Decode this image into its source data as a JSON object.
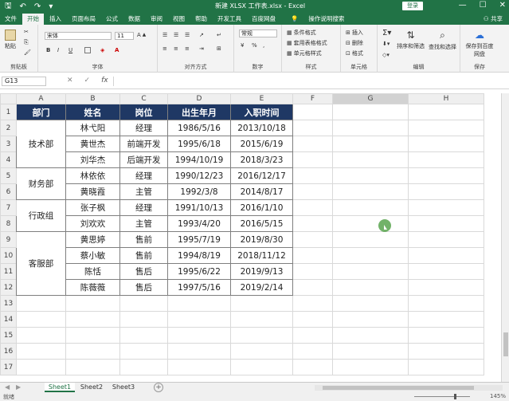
{
  "titlebar": {
    "title": "新建 XLSX 工作表.xlsx  -  Excel",
    "login": "登录",
    "save_icon": "save-icon",
    "undo_icon": "undo-icon",
    "redo_icon": "redo-icon",
    "min": "—",
    "max": "☐",
    "close": "✕"
  },
  "tabs": [
    "文件",
    "开始",
    "插入",
    "页面布局",
    "公式",
    "数据",
    "审阅",
    "视图",
    "帮助",
    "开发工具",
    "百度网盘"
  ],
  "tellme": "操作说明搜索",
  "share": "共享",
  "ribbon": {
    "clipboard": {
      "label": "剪贴板",
      "paste": "粘贴"
    },
    "font": {
      "label": "字体",
      "name": "宋体",
      "size": "11",
      "bold": "B",
      "italic": "I",
      "underline": "U"
    },
    "align": {
      "label": "对齐方式"
    },
    "number": {
      "label": "数字",
      "format": "常规"
    },
    "styles": {
      "label": "样式",
      "cond": "条件格式",
      "table": "套用表格格式",
      "cell": "单元格样式"
    },
    "cells": {
      "label": "单元格",
      "insert": "插入",
      "delete": "删除",
      "format": "格式"
    },
    "editing": {
      "label": "编辑",
      "sort": "排序和筛选",
      "find": "查找和选择"
    },
    "save": {
      "label": "保存",
      "btn": "保存到百度网盘"
    }
  },
  "namebox": "G13",
  "fx": "fx",
  "columns": [
    "A",
    "B",
    "C",
    "D",
    "E",
    "F",
    "G",
    "H"
  ],
  "rows": [
    "1",
    "2",
    "3",
    "4",
    "5",
    "6",
    "7",
    "8",
    "9",
    "10",
    "11",
    "12",
    "13",
    "14",
    "15",
    "16",
    "17"
  ],
  "table": {
    "headers": [
      "部门",
      "姓名",
      "岗位",
      "出生年月",
      "入职时间"
    ],
    "departments": [
      {
        "name": "技术部",
        "rows": [
          [
            "林弋阳",
            "经理",
            "1986/5/16",
            "2013/10/18"
          ],
          [
            "黄世杰",
            "前端开发",
            "1995/6/18",
            "2015/6/19"
          ],
          [
            "刘华杰",
            "后端开发",
            "1994/10/19",
            "2018/3/23"
          ]
        ]
      },
      {
        "name": "财务部",
        "rows": [
          [
            "林依依",
            "经理",
            "1990/12/23",
            "2016/12/17"
          ],
          [
            "黄晓霞",
            "主管",
            "1992/3/8",
            "2014/8/17"
          ]
        ]
      },
      {
        "name": "行政组",
        "rows": [
          [
            "张子枫",
            "经理",
            "1991/10/13",
            "2016/1/10"
          ],
          [
            "刘欢欢",
            "主管",
            "1993/4/20",
            "2016/5/15"
          ]
        ]
      },
      {
        "name": "客服部",
        "rows": [
          [
            "黄思婷",
            "售前",
            "1995/7/19",
            "2019/8/30"
          ],
          [
            "蔡小敏",
            "售前",
            "1994/8/19",
            "2018/11/12"
          ],
          [
            "陈恬",
            "售后",
            "1995/6/22",
            "2019/9/13"
          ],
          [
            "陈薇薇",
            "售后",
            "1997/5/16",
            "2019/2/14"
          ]
        ]
      }
    ]
  },
  "sheets": [
    "Sheet1",
    "Sheet2",
    "Sheet3"
  ],
  "add_sheet": "+",
  "status": {
    "ready": "就绪",
    "zoom": "145%"
  }
}
